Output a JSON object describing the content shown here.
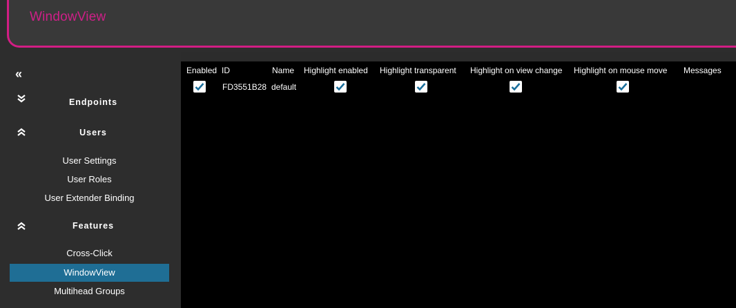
{
  "app": {
    "title": "WindowView"
  },
  "sidebar": {
    "collapse_icon": "double-chevron-left-icon",
    "sections": [
      {
        "label": "Endpoints",
        "chevron": "double-chevron-down-icon"
      },
      {
        "label": "Users",
        "chevron": "double-chevron-up-icon",
        "items": [
          "User Settings",
          "User Roles",
          "User Extender Binding"
        ]
      },
      {
        "label": "Features",
        "chevron": "double-chevron-up-icon",
        "items": [
          "Cross-Click",
          "WindowView",
          "Multihead Groups"
        ]
      }
    ],
    "active_item": "WindowView"
  },
  "table": {
    "columns": [
      "Enabled",
      "ID",
      "Name",
      "Highlight enabled",
      "Highlight transparent",
      "Highlight on view change",
      "Highlight on mouse move",
      "Messages"
    ],
    "rows": [
      {
        "enabled": true,
        "id": "FD3551B28",
        "name": "default",
        "highlight_enabled": true,
        "highlight_transparent": true,
        "highlight_on_view_change": true,
        "highlight_on_mouse_move": true,
        "messages": ""
      }
    ]
  },
  "colors": {
    "accent": "#d21d84",
    "active_nav": "#1f6e95",
    "checkmark": "#1a6f9c"
  }
}
